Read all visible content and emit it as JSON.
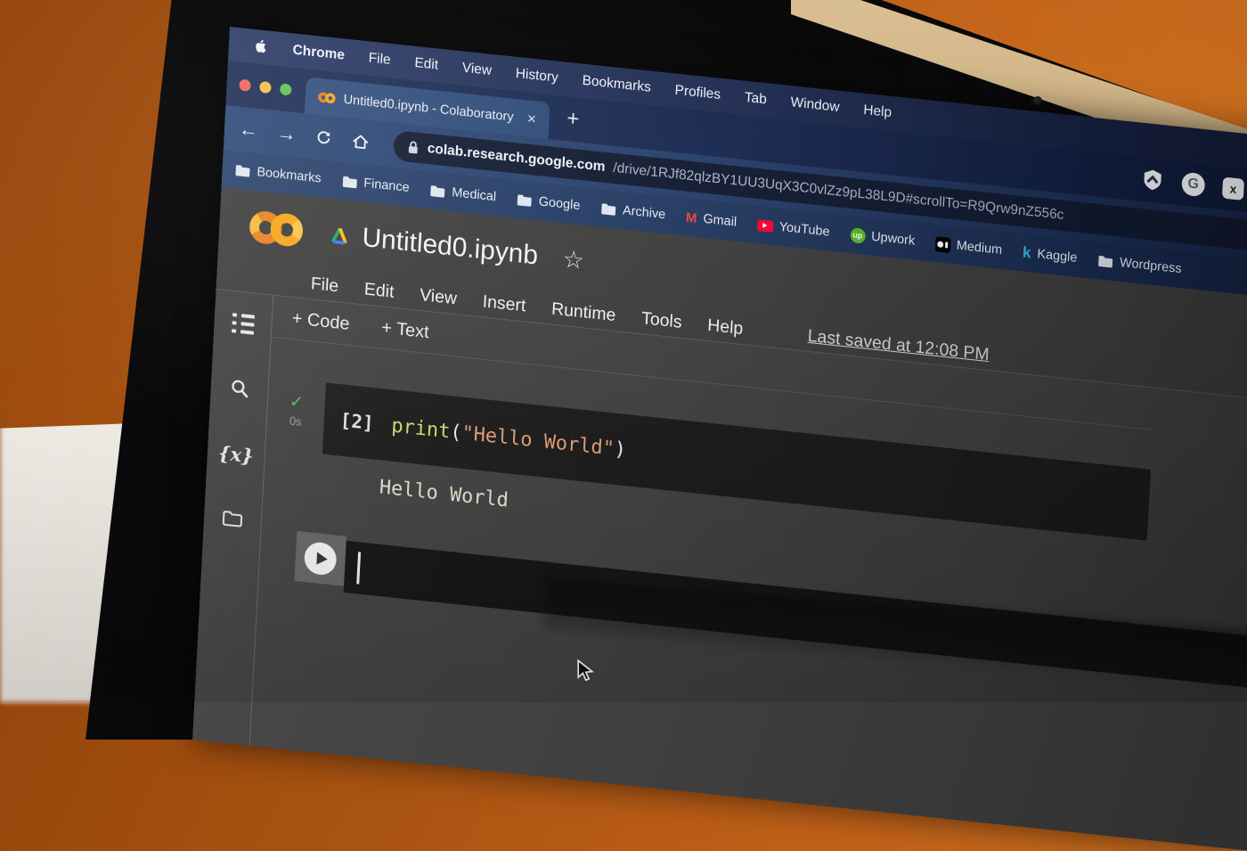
{
  "menubar": {
    "items": [
      "Chrome",
      "File",
      "Edit",
      "View",
      "History",
      "Bookmarks",
      "Profiles",
      "Tab",
      "Window",
      "Help"
    ]
  },
  "browser": {
    "tab_title": "Untitled0.ipynb - Colaboratory",
    "tab_close": "✕",
    "new_tab": "+",
    "extension_g": "G",
    "extension_x": "x",
    "nav": {
      "back": "←",
      "forward": "→"
    },
    "url": {
      "host": "colab.research.google.com",
      "path": "/drive/1RJf82qlzBY1UU3UqX3C0vlZz9pL38L9D#scrollTo=R9Qrw9nZ556c"
    },
    "bookmarks": [
      {
        "label": "Bookmarks"
      },
      {
        "label": "Finance"
      },
      {
        "label": "Medical"
      },
      {
        "label": "Google"
      },
      {
        "label": "Archive"
      },
      {
        "label": "Gmail",
        "glyph": "M"
      },
      {
        "label": "YouTube"
      },
      {
        "label": "Upwork",
        "glyph": "up"
      },
      {
        "label": "Medium"
      },
      {
        "label": "Kaggle",
        "glyph": "k"
      },
      {
        "label": "Wordpress"
      }
    ]
  },
  "colab": {
    "title": "Untitled0.ipynb",
    "star": "☆",
    "menu": [
      "File",
      "Edit",
      "View",
      "Insert",
      "Runtime",
      "Tools",
      "Help"
    ],
    "last_saved": "Last saved at 12:08 PM",
    "add_code": "+ Code",
    "add_text": "+ Text",
    "cell": {
      "status": "✓",
      "duration": "0s",
      "exec_count": "[2]",
      "fn": "print",
      "paren_open": "(",
      "string": "\"Hello World\"",
      "paren_close": ")",
      "output": "Hello World"
    }
  },
  "colors": {
    "colab_orange": "#e8821e",
    "colab_amber": "#f9a61a",
    "code_fn": "#ccd76f",
    "code_string": "#dd9b73",
    "check_green": "#55b85c"
  }
}
